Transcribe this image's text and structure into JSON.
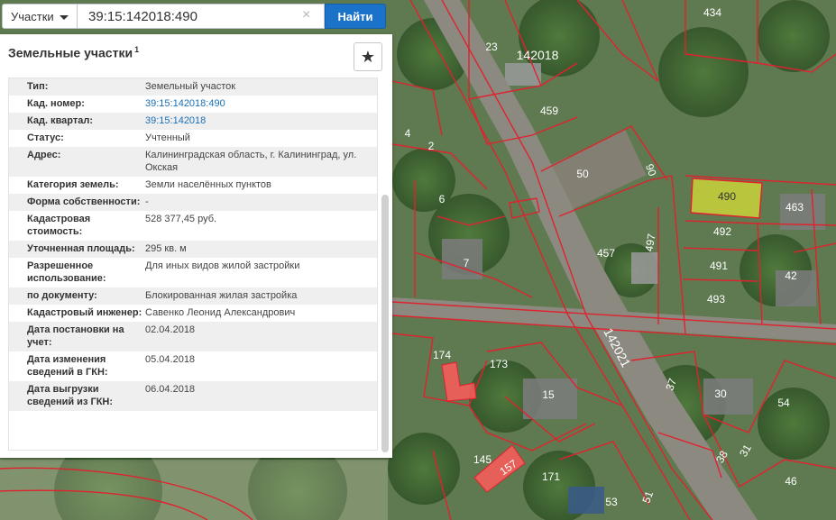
{
  "search": {
    "type_label": "Участки",
    "query": "39:15:142018:490",
    "button_label": "Найти",
    "clear_icon": "×"
  },
  "panel": {
    "title": "Земельные участки",
    "title_sup": "1",
    "star_icon": "★",
    "rows": [
      {
        "key": "Тип:",
        "value": "Земельный участок"
      },
      {
        "key": "Кад. номер:",
        "value": "39:15:142018:490"
      },
      {
        "key": "Кад. квартал:",
        "value": "39:15:142018"
      },
      {
        "key": "Статус:",
        "value": "Учтенный"
      },
      {
        "key": "Адрес:",
        "value": "Калининградская область, г. Калининград, ул. Окская"
      },
      {
        "key": "Категория земель:",
        "value": "Земли населённых пунктов"
      },
      {
        "key": "Форма собственности:",
        "value": "-"
      },
      {
        "key": "Кадастровая стоимость:",
        "value": "528 377,45 руб."
      },
      {
        "key": "Уточненная площадь:",
        "value": "295 кв. м"
      },
      {
        "key": "Разрешенное использование:",
        "value": "Для иных видов жилой застройки"
      },
      {
        "key": "по документу:",
        "value": "Блокированная жилая застройка"
      },
      {
        "key": "Кадастровый инженер:",
        "value": "Савенко Леонид Александрович"
      },
      {
        "key": "Дата постановки на учет:",
        "value": "02.04.2018"
      },
      {
        "key": "Дата изменения сведений в ГКН:",
        "value": "05.04.2018"
      },
      {
        "key": "Дата выгрузки сведений из ГКН:",
        "value": "06.04.2018"
      }
    ]
  },
  "map": {
    "quarter_label": "142018",
    "road_label": "142021",
    "selected_parcel": "490",
    "parcel_labels": [
      "434",
      "23",
      "459",
      "4",
      "2",
      "6",
      "50",
      "90",
      "7",
      "457",
      "497",
      "490",
      "463",
      "492",
      "491",
      "42",
      "493",
      "174",
      "173",
      "15",
      "37",
      "30",
      "54",
      "145",
      "157",
      "171",
      "38",
      "31",
      "53",
      "51",
      "46"
    ],
    "colors": {
      "parcel_border": "#e0222f",
      "selected_fill": "#c9d33a",
      "highlight_fill": "#ff5a5a",
      "search_button": "#1a73c8"
    }
  }
}
